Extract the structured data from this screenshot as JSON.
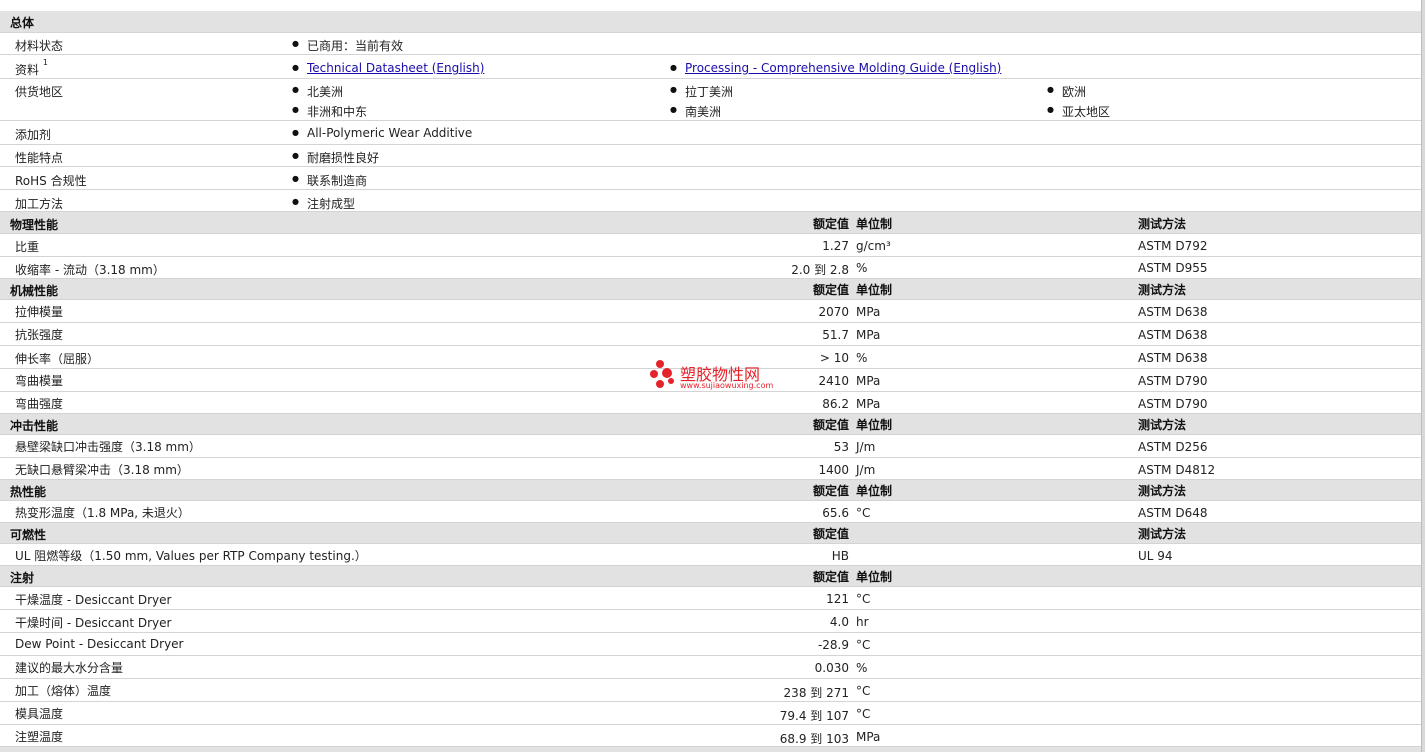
{
  "sections": {
    "general": {
      "title": "总体",
      "material_status": {
        "label": "材料状态",
        "value": "已商用：当前有效"
      },
      "documents": {
        "label": "资料",
        "footnote": "1",
        "link1": "Technical Datasheet (English)",
        "link2": "Processing - Comprehensive Molding Guide (English)"
      },
      "availability": {
        "label": "供货地区",
        "regions": [
          "北美洲",
          "拉丁美洲",
          "欧洲",
          "非洲和中东",
          "南美洲",
          "亚太地区"
        ]
      },
      "additive": {
        "label": "添加剂",
        "value": "All-Polymeric Wear Additive"
      },
      "features": {
        "label": "性能特点",
        "value": "耐磨损性良好"
      },
      "rohs": {
        "label": "RoHS 合规性",
        "value": "联系制造商"
      },
      "processing_method": {
        "label": "加工方法",
        "value": "注射成型"
      }
    },
    "physical": {
      "title": "物理性能",
      "nominal": "额定值",
      "unit": "单位制",
      "test": "测试方法",
      "rows": [
        {
          "label": "比重",
          "value": "1.27",
          "unit": "g/cm³",
          "test": "ASTM D792"
        },
        {
          "label": "收缩率  - 流动（3.18 mm）",
          "value": "2.0 到  2.8",
          "unit": "%",
          "test": "ASTM D955"
        }
      ]
    },
    "mechanical": {
      "title": "机械性能",
      "nominal": "额定值",
      "unit": "单位制",
      "test": "测试方法",
      "rows": [
        {
          "label": "拉伸模量",
          "value": "2070",
          "unit": "MPa",
          "test": "ASTM D638"
        },
        {
          "label": "抗张强度",
          "value": "51.7",
          "unit": "MPa",
          "test": "ASTM D638"
        },
        {
          "label": "伸长率（屈服）",
          "value": "> 10",
          "unit": "%",
          "test": "ASTM D638"
        },
        {
          "label": "弯曲模量",
          "value": "2410",
          "unit": "MPa",
          "test": "ASTM D790"
        },
        {
          "label": "弯曲强度",
          "value": "86.2",
          "unit": "MPa",
          "test": "ASTM D790"
        }
      ]
    },
    "impact": {
      "title": "冲击性能",
      "nominal": "额定值",
      "unit": "单位制",
      "test": "测试方法",
      "rows": [
        {
          "label": "悬壁梁缺口冲击强度（3.18 mm）",
          "value": "53",
          "unit": "J/m",
          "test": "ASTM D256"
        },
        {
          "label": "无缺口悬臂梁冲击（3.18 mm）",
          "value": "1400",
          "unit": "J/m",
          "test": "ASTM D4812"
        }
      ]
    },
    "thermal": {
      "title": "热性能",
      "nominal": "额定值",
      "unit": "单位制",
      "test": "测试方法",
      "rows": [
        {
          "label": "热变形温度（1.8 MPa, 未退火）",
          "value": "65.6",
          "unit": "°C",
          "test": "ASTM D648"
        }
      ]
    },
    "flammability": {
      "title": "可燃性",
      "nominal": "额定值",
      "test": "测试方法",
      "rows": [
        {
          "label": "UL 阻燃等级（1.50 mm, Values per RTP Company testing.）",
          "value": "HB",
          "test": "UL 94"
        }
      ]
    },
    "injection": {
      "title": "注射",
      "nominal": "额定值",
      "unit": "单位制",
      "rows": [
        {
          "label": "干燥温度  - Desiccant Dryer",
          "value": "121",
          "unit": "°C"
        },
        {
          "label": "干燥时间  - Desiccant Dryer",
          "value": "4.0",
          "unit": "hr"
        },
        {
          "label": "Dew Point - Desiccant Dryer",
          "value": "-28.9",
          "unit": "°C"
        },
        {
          "label": "建议的最大水分含量",
          "value": "0.030",
          "unit": "%"
        },
        {
          "label": "加工（熔体）温度",
          "value": "238 到  271",
          "unit": "°C"
        },
        {
          "label": "模具温度",
          "value": "79.4 到  107",
          "unit": "°C"
        },
        {
          "label": "注塑温度",
          "value": "68.9 到  103",
          "unit": "MPa"
        }
      ]
    }
  },
  "watermark": {
    "text": "塑胶物性网",
    "url": "www.sujiaowuxing.com"
  },
  "colors": {
    "section_bg": "#e2e2e2",
    "link": "#1a0dab",
    "watermark": "#e5232b"
  }
}
